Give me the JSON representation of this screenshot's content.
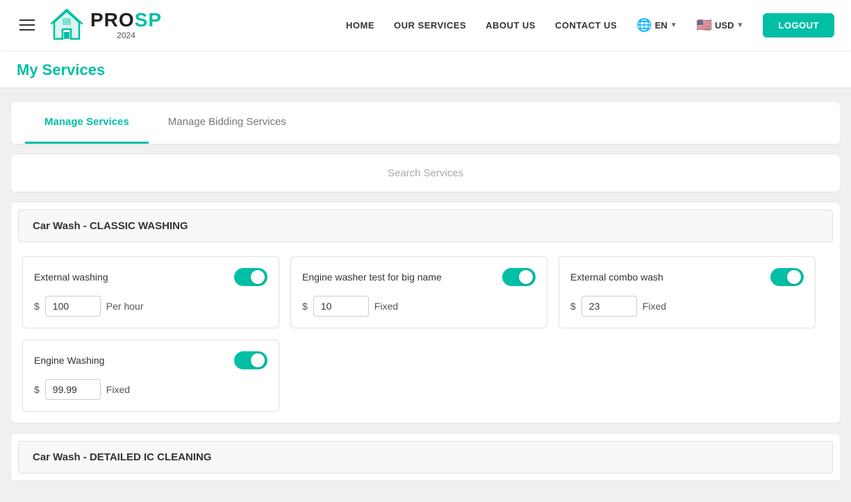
{
  "header": {
    "logo_pro": "PRO",
    "logo_sp": "SP",
    "logo_year": "2024",
    "nav_items": [
      {
        "label": "HOME",
        "id": "home"
      },
      {
        "label": "OUR SERVICES",
        "id": "our-services"
      },
      {
        "label": "ABOUT US",
        "id": "about-us"
      },
      {
        "label": "CONTACT US",
        "id": "contact-us"
      }
    ],
    "lang_label": "EN",
    "currency_label": "USD",
    "logout_label": "LOGOUT"
  },
  "page_title": "My Services",
  "tabs": [
    {
      "label": "Manage Services",
      "active": true
    },
    {
      "label": "Manage Bidding Services",
      "active": false
    }
  ],
  "search_placeholder": "Search Services",
  "service_groups": [
    {
      "group_name": "Car Wash - CLASSIC WASHING",
      "services": [
        {
          "name": "External washing",
          "enabled": true,
          "price": "100",
          "price_type": "Per hour"
        },
        {
          "name": "Engine washer test for big name",
          "enabled": true,
          "price": "10",
          "price_type": "Fixed"
        },
        {
          "name": "External combo wash",
          "enabled": true,
          "price": "23",
          "price_type": "Fixed"
        },
        {
          "name": "Engine Washing",
          "enabled": true,
          "price": "99.99",
          "price_type": "Fixed"
        }
      ]
    },
    {
      "group_name": "Car Wash - DETAILED IC CLEANING",
      "services": []
    }
  ]
}
